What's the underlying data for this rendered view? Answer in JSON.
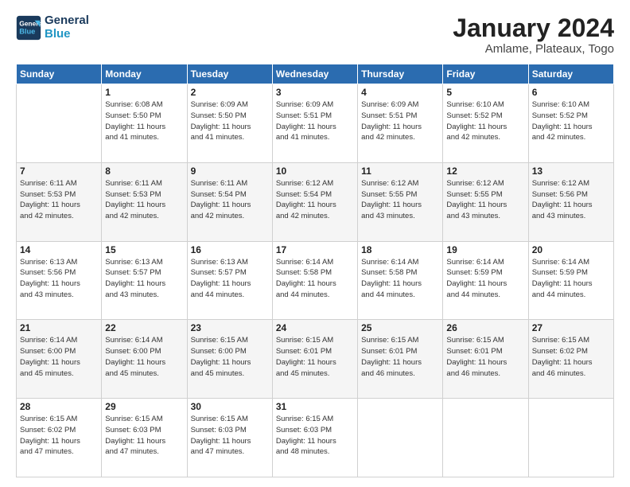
{
  "header": {
    "logo_line1": "General",
    "logo_line2": "Blue",
    "month": "January 2024",
    "location": "Amlame, Plateaux, Togo"
  },
  "weekdays": [
    "Sunday",
    "Monday",
    "Tuesday",
    "Wednesday",
    "Thursday",
    "Friday",
    "Saturday"
  ],
  "weeks": [
    [
      {
        "day": "",
        "info": ""
      },
      {
        "day": "1",
        "info": "Sunrise: 6:08 AM\nSunset: 5:50 PM\nDaylight: 11 hours\nand 41 minutes."
      },
      {
        "day": "2",
        "info": "Sunrise: 6:09 AM\nSunset: 5:50 PM\nDaylight: 11 hours\nand 41 minutes."
      },
      {
        "day": "3",
        "info": "Sunrise: 6:09 AM\nSunset: 5:51 PM\nDaylight: 11 hours\nand 41 minutes."
      },
      {
        "day": "4",
        "info": "Sunrise: 6:09 AM\nSunset: 5:51 PM\nDaylight: 11 hours\nand 42 minutes."
      },
      {
        "day": "5",
        "info": "Sunrise: 6:10 AM\nSunset: 5:52 PM\nDaylight: 11 hours\nand 42 minutes."
      },
      {
        "day": "6",
        "info": "Sunrise: 6:10 AM\nSunset: 5:52 PM\nDaylight: 11 hours\nand 42 minutes."
      }
    ],
    [
      {
        "day": "7",
        "info": "Sunrise: 6:11 AM\nSunset: 5:53 PM\nDaylight: 11 hours\nand 42 minutes."
      },
      {
        "day": "8",
        "info": "Sunrise: 6:11 AM\nSunset: 5:53 PM\nDaylight: 11 hours\nand 42 minutes."
      },
      {
        "day": "9",
        "info": "Sunrise: 6:11 AM\nSunset: 5:54 PM\nDaylight: 11 hours\nand 42 minutes."
      },
      {
        "day": "10",
        "info": "Sunrise: 6:12 AM\nSunset: 5:54 PM\nDaylight: 11 hours\nand 42 minutes."
      },
      {
        "day": "11",
        "info": "Sunrise: 6:12 AM\nSunset: 5:55 PM\nDaylight: 11 hours\nand 43 minutes."
      },
      {
        "day": "12",
        "info": "Sunrise: 6:12 AM\nSunset: 5:55 PM\nDaylight: 11 hours\nand 43 minutes."
      },
      {
        "day": "13",
        "info": "Sunrise: 6:12 AM\nSunset: 5:56 PM\nDaylight: 11 hours\nand 43 minutes."
      }
    ],
    [
      {
        "day": "14",
        "info": "Sunrise: 6:13 AM\nSunset: 5:56 PM\nDaylight: 11 hours\nand 43 minutes."
      },
      {
        "day": "15",
        "info": "Sunrise: 6:13 AM\nSunset: 5:57 PM\nDaylight: 11 hours\nand 43 minutes."
      },
      {
        "day": "16",
        "info": "Sunrise: 6:13 AM\nSunset: 5:57 PM\nDaylight: 11 hours\nand 44 minutes."
      },
      {
        "day": "17",
        "info": "Sunrise: 6:14 AM\nSunset: 5:58 PM\nDaylight: 11 hours\nand 44 minutes."
      },
      {
        "day": "18",
        "info": "Sunrise: 6:14 AM\nSunset: 5:58 PM\nDaylight: 11 hours\nand 44 minutes."
      },
      {
        "day": "19",
        "info": "Sunrise: 6:14 AM\nSunset: 5:59 PM\nDaylight: 11 hours\nand 44 minutes."
      },
      {
        "day": "20",
        "info": "Sunrise: 6:14 AM\nSunset: 5:59 PM\nDaylight: 11 hours\nand 44 minutes."
      }
    ],
    [
      {
        "day": "21",
        "info": "Sunrise: 6:14 AM\nSunset: 6:00 PM\nDaylight: 11 hours\nand 45 minutes."
      },
      {
        "day": "22",
        "info": "Sunrise: 6:14 AM\nSunset: 6:00 PM\nDaylight: 11 hours\nand 45 minutes."
      },
      {
        "day": "23",
        "info": "Sunrise: 6:15 AM\nSunset: 6:00 PM\nDaylight: 11 hours\nand 45 minutes."
      },
      {
        "day": "24",
        "info": "Sunrise: 6:15 AM\nSunset: 6:01 PM\nDaylight: 11 hours\nand 45 minutes."
      },
      {
        "day": "25",
        "info": "Sunrise: 6:15 AM\nSunset: 6:01 PM\nDaylight: 11 hours\nand 46 minutes."
      },
      {
        "day": "26",
        "info": "Sunrise: 6:15 AM\nSunset: 6:01 PM\nDaylight: 11 hours\nand 46 minutes."
      },
      {
        "day": "27",
        "info": "Sunrise: 6:15 AM\nSunset: 6:02 PM\nDaylight: 11 hours\nand 46 minutes."
      }
    ],
    [
      {
        "day": "28",
        "info": "Sunrise: 6:15 AM\nSunset: 6:02 PM\nDaylight: 11 hours\nand 47 minutes."
      },
      {
        "day": "29",
        "info": "Sunrise: 6:15 AM\nSunset: 6:03 PM\nDaylight: 11 hours\nand 47 minutes."
      },
      {
        "day": "30",
        "info": "Sunrise: 6:15 AM\nSunset: 6:03 PM\nDaylight: 11 hours\nand 47 minutes."
      },
      {
        "day": "31",
        "info": "Sunrise: 6:15 AM\nSunset: 6:03 PM\nDaylight: 11 hours\nand 48 minutes."
      },
      {
        "day": "",
        "info": ""
      },
      {
        "day": "",
        "info": ""
      },
      {
        "day": "",
        "info": ""
      }
    ]
  ]
}
